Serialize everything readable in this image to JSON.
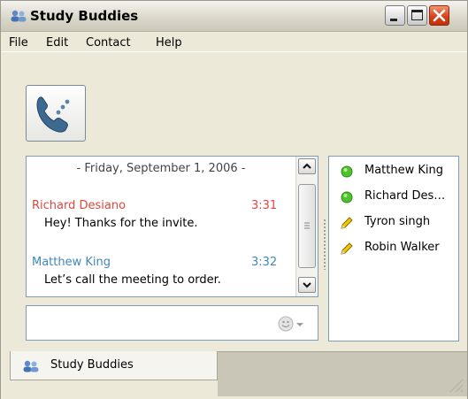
{
  "window": {
    "title": "Study Buddies"
  },
  "menu": [
    "File",
    "Edit",
    "Contact",
    "Help"
  ],
  "chat": {
    "date_line": "- Friday, September 1, 2006 -",
    "messages": [
      {
        "name": "Richard Desiano",
        "time": "3:31",
        "text": "Hey! Thanks for the invite.",
        "color": "#e2463c"
      },
      {
        "name": "Matthew King",
        "time": "3:32",
        "text": "Let’s call the meeting to order.",
        "color": "#3f87b8"
      }
    ]
  },
  "contacts": [
    {
      "name": "Matthew King",
      "status": "online",
      "icon": "green-dot-icon"
    },
    {
      "name": "Richard Des…",
      "status": "online",
      "icon": "green-dot-icon"
    },
    {
      "name": "Tyron singh",
      "status": "typing",
      "icon": "pencil-icon"
    },
    {
      "name": "Robin Walker",
      "status": "typing",
      "icon": "pencil-icon"
    }
  ],
  "tabs": [
    {
      "label": "Study Buddies"
    }
  ],
  "colors": {
    "online": "#4ec32b",
    "pencil": "#e8b800",
    "accent": "#7f9db9"
  }
}
